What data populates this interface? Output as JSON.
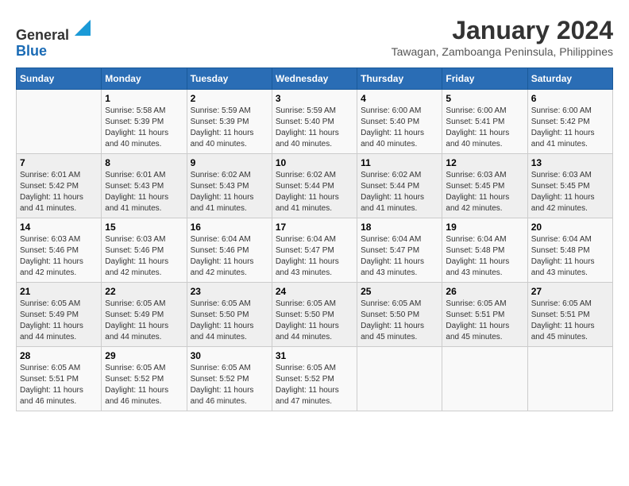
{
  "header": {
    "logo_general": "General",
    "logo_blue": "Blue",
    "month": "January 2024",
    "location": "Tawagan, Zamboanga Peninsula, Philippines"
  },
  "days_of_week": [
    "Sunday",
    "Monday",
    "Tuesday",
    "Wednesday",
    "Thursday",
    "Friday",
    "Saturday"
  ],
  "weeks": [
    [
      {
        "day": "",
        "info": ""
      },
      {
        "day": "1",
        "info": "Sunrise: 5:58 AM\nSunset: 5:39 PM\nDaylight: 11 hours\nand 40 minutes."
      },
      {
        "day": "2",
        "info": "Sunrise: 5:59 AM\nSunset: 5:39 PM\nDaylight: 11 hours\nand 40 minutes."
      },
      {
        "day": "3",
        "info": "Sunrise: 5:59 AM\nSunset: 5:40 PM\nDaylight: 11 hours\nand 40 minutes."
      },
      {
        "day": "4",
        "info": "Sunrise: 6:00 AM\nSunset: 5:40 PM\nDaylight: 11 hours\nand 40 minutes."
      },
      {
        "day": "5",
        "info": "Sunrise: 6:00 AM\nSunset: 5:41 PM\nDaylight: 11 hours\nand 40 minutes."
      },
      {
        "day": "6",
        "info": "Sunrise: 6:00 AM\nSunset: 5:42 PM\nDaylight: 11 hours\nand 41 minutes."
      }
    ],
    [
      {
        "day": "7",
        "info": "Sunrise: 6:01 AM\nSunset: 5:42 PM\nDaylight: 11 hours\nand 41 minutes."
      },
      {
        "day": "8",
        "info": "Sunrise: 6:01 AM\nSunset: 5:43 PM\nDaylight: 11 hours\nand 41 minutes."
      },
      {
        "day": "9",
        "info": "Sunrise: 6:02 AM\nSunset: 5:43 PM\nDaylight: 11 hours\nand 41 minutes."
      },
      {
        "day": "10",
        "info": "Sunrise: 6:02 AM\nSunset: 5:44 PM\nDaylight: 11 hours\nand 41 minutes."
      },
      {
        "day": "11",
        "info": "Sunrise: 6:02 AM\nSunset: 5:44 PM\nDaylight: 11 hours\nand 41 minutes."
      },
      {
        "day": "12",
        "info": "Sunrise: 6:03 AM\nSunset: 5:45 PM\nDaylight: 11 hours\nand 42 minutes."
      },
      {
        "day": "13",
        "info": "Sunrise: 6:03 AM\nSunset: 5:45 PM\nDaylight: 11 hours\nand 42 minutes."
      }
    ],
    [
      {
        "day": "14",
        "info": "Sunrise: 6:03 AM\nSunset: 5:46 PM\nDaylight: 11 hours\nand 42 minutes."
      },
      {
        "day": "15",
        "info": "Sunrise: 6:03 AM\nSunset: 5:46 PM\nDaylight: 11 hours\nand 42 minutes."
      },
      {
        "day": "16",
        "info": "Sunrise: 6:04 AM\nSunset: 5:46 PM\nDaylight: 11 hours\nand 42 minutes."
      },
      {
        "day": "17",
        "info": "Sunrise: 6:04 AM\nSunset: 5:47 PM\nDaylight: 11 hours\nand 43 minutes."
      },
      {
        "day": "18",
        "info": "Sunrise: 6:04 AM\nSunset: 5:47 PM\nDaylight: 11 hours\nand 43 minutes."
      },
      {
        "day": "19",
        "info": "Sunrise: 6:04 AM\nSunset: 5:48 PM\nDaylight: 11 hours\nand 43 minutes."
      },
      {
        "day": "20",
        "info": "Sunrise: 6:04 AM\nSunset: 5:48 PM\nDaylight: 11 hours\nand 43 minutes."
      }
    ],
    [
      {
        "day": "21",
        "info": "Sunrise: 6:05 AM\nSunset: 5:49 PM\nDaylight: 11 hours\nand 44 minutes."
      },
      {
        "day": "22",
        "info": "Sunrise: 6:05 AM\nSunset: 5:49 PM\nDaylight: 11 hours\nand 44 minutes."
      },
      {
        "day": "23",
        "info": "Sunrise: 6:05 AM\nSunset: 5:50 PM\nDaylight: 11 hours\nand 44 minutes."
      },
      {
        "day": "24",
        "info": "Sunrise: 6:05 AM\nSunset: 5:50 PM\nDaylight: 11 hours\nand 44 minutes."
      },
      {
        "day": "25",
        "info": "Sunrise: 6:05 AM\nSunset: 5:50 PM\nDaylight: 11 hours\nand 45 minutes."
      },
      {
        "day": "26",
        "info": "Sunrise: 6:05 AM\nSunset: 5:51 PM\nDaylight: 11 hours\nand 45 minutes."
      },
      {
        "day": "27",
        "info": "Sunrise: 6:05 AM\nSunset: 5:51 PM\nDaylight: 11 hours\nand 45 minutes."
      }
    ],
    [
      {
        "day": "28",
        "info": "Sunrise: 6:05 AM\nSunset: 5:51 PM\nDaylight: 11 hours\nand 46 minutes."
      },
      {
        "day": "29",
        "info": "Sunrise: 6:05 AM\nSunset: 5:52 PM\nDaylight: 11 hours\nand 46 minutes."
      },
      {
        "day": "30",
        "info": "Sunrise: 6:05 AM\nSunset: 5:52 PM\nDaylight: 11 hours\nand 46 minutes."
      },
      {
        "day": "31",
        "info": "Sunrise: 6:05 AM\nSunset: 5:52 PM\nDaylight: 11 hours\nand 47 minutes."
      },
      {
        "day": "",
        "info": ""
      },
      {
        "day": "",
        "info": ""
      },
      {
        "day": "",
        "info": ""
      }
    ]
  ]
}
